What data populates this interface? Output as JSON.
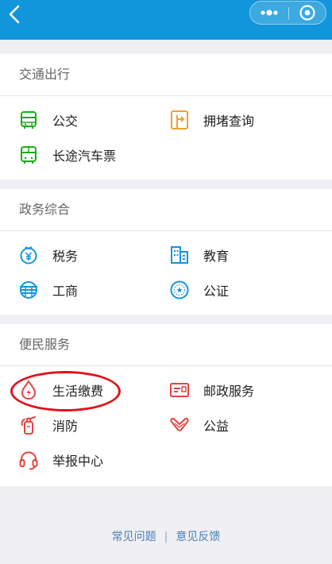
{
  "nav": {
    "back_icon": "back-arrow-icon",
    "more_icon": "more-dots-icon",
    "close_icon": "target-circle-icon",
    "color": "#1296db"
  },
  "sections": [
    {
      "title": "交通出行",
      "items": [
        {
          "label": "公交",
          "icon": "bus-icon",
          "color": "#1aad19"
        },
        {
          "label": "拥堵查询",
          "icon": "road-sign-icon",
          "color": "#f0a032"
        },
        {
          "label": "长途汽车票",
          "icon": "coach-bus-icon",
          "color": "#1aad19"
        }
      ]
    },
    {
      "title": "政务综合",
      "items": [
        {
          "label": "税务",
          "icon": "tax-icon",
          "color": "#1296db"
        },
        {
          "label": "教育",
          "icon": "school-building-icon",
          "color": "#1296db"
        },
        {
          "label": "工商",
          "icon": "industry-commerce-icon",
          "color": "#1296db"
        },
        {
          "label": "公证",
          "icon": "notary-seal-icon",
          "color": "#1296db"
        }
      ]
    },
    {
      "title": "便民服务",
      "items": [
        {
          "label": "生活缴费",
          "icon": "utility-drop-icon",
          "color": "#e64340"
        },
        {
          "label": "邮政服务",
          "icon": "postal-card-icon",
          "color": "#e64340"
        },
        {
          "label": "消防",
          "icon": "fire-extinguisher-icon",
          "color": "#e64340"
        },
        {
          "label": "公益",
          "icon": "charity-heart-hand-icon",
          "color": "#e64340"
        },
        {
          "label": "举报中心",
          "icon": "headset-icon",
          "color": "#e64340"
        }
      ]
    }
  ],
  "footer": {
    "faq": "常见问题",
    "separator": "|",
    "feedback": "意见反馈"
  }
}
